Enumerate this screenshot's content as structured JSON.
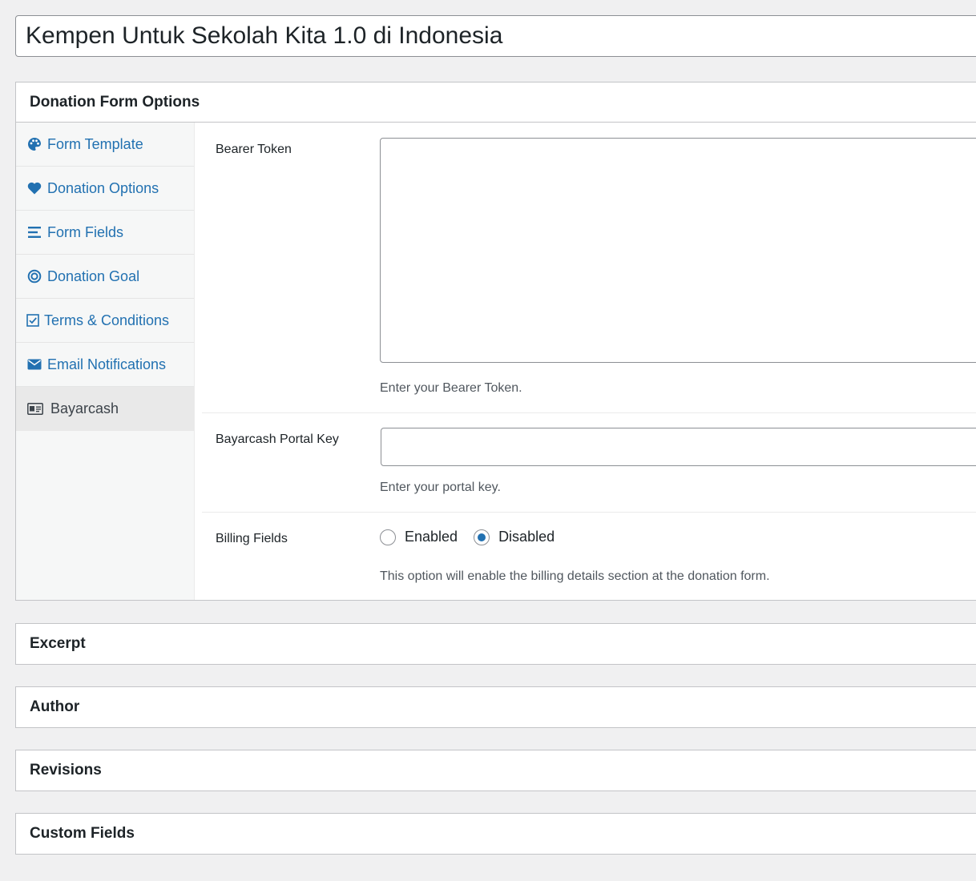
{
  "post_title": "Kempen Untuk Sekolah Kita 1.0 di Indonesia",
  "donation_form_options": {
    "heading": "Donation Form Options",
    "tabs": [
      {
        "label": "Form Template",
        "icon": "palette-icon"
      },
      {
        "label": "Donation Options",
        "icon": "heart-icon"
      },
      {
        "label": "Form Fields",
        "icon": "list-icon"
      },
      {
        "label": "Donation Goal",
        "icon": "target-icon"
      },
      {
        "label": "Terms & Conditions",
        "icon": "checkbox-icon"
      },
      {
        "label": "Email Notifications",
        "icon": "envelope-icon"
      },
      {
        "label": "Bayarcash",
        "icon": "id-card-icon",
        "active": true
      }
    ],
    "fields": {
      "bearer_token": {
        "label": "Bearer Token",
        "value": "",
        "description": "Enter your Bearer Token."
      },
      "portal_key": {
        "label": "Bayarcash Portal Key",
        "value": "",
        "description": "Enter your portal key."
      },
      "billing_fields": {
        "label": "Billing Fields",
        "options": [
          "Enabled",
          "Disabled"
        ],
        "selected": "Disabled",
        "description": "This option will enable the billing details section at the donation form."
      }
    }
  },
  "boxes": {
    "excerpt": "Excerpt",
    "author": "Author",
    "revisions": "Revisions",
    "custom_fields": "Custom Fields"
  },
  "colors": {
    "link": "#2271b1",
    "background": "#f0f0f1",
    "border": "#c3c4c7"
  }
}
